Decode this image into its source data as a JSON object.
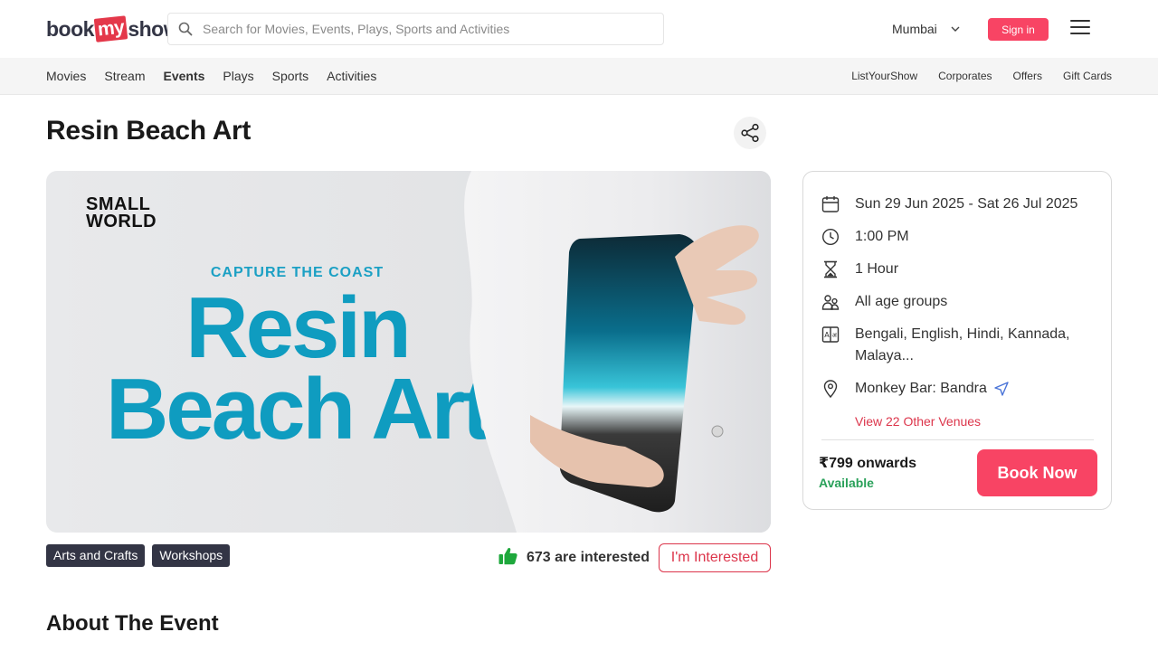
{
  "header": {
    "logo_text_left": "book",
    "logo_text_mid": "my",
    "logo_text_right": "show",
    "search_placeholder": "Search for Movies, Events, Plays, Sports and Activities",
    "city": "Mumbai",
    "signin_label": "Sign in"
  },
  "nav": {
    "left": [
      {
        "label": "Movies"
      },
      {
        "label": "Stream"
      },
      {
        "label": "Events",
        "active": true
      },
      {
        "label": "Plays"
      },
      {
        "label": "Sports"
      },
      {
        "label": "Activities"
      }
    ],
    "right": [
      {
        "label": "ListYourShow"
      },
      {
        "label": "Corporates"
      },
      {
        "label": "Offers"
      },
      {
        "label": "Gift Cards"
      }
    ]
  },
  "event": {
    "title": "Resin Beach Art",
    "banner": {
      "brand_line1": "SMALL",
      "brand_line2": "WORLD",
      "tagline": "CAPTURE THE COAST",
      "headline_line1": "Resin",
      "headline_line2": "Beach Art"
    },
    "tags": [
      "Arts and Crafts",
      "Workshops"
    ],
    "interested_count_text": "673 are interested",
    "interested_button": "I'm Interested",
    "about_heading": "About The Event"
  },
  "details": {
    "date": "Sun 29 Jun 2025 - Sat 26 Jul 2025",
    "time": "1:00 PM",
    "duration": "1 Hour",
    "age": "All age groups",
    "languages": "Bengali, English, Hindi, Kannada, Malaya...",
    "venue": "Monkey Bar: Bandra",
    "other_venues": "View 22 Other Venues",
    "price": "₹799 onwards",
    "availability": "Available",
    "book_label": "Book Now"
  },
  "colors": {
    "brand_red": "#f84464",
    "accent_red": "#dc354b",
    "tag_bg": "#333545",
    "banner_blue": "#0f9cc0",
    "available_green": "#2aa15a"
  }
}
